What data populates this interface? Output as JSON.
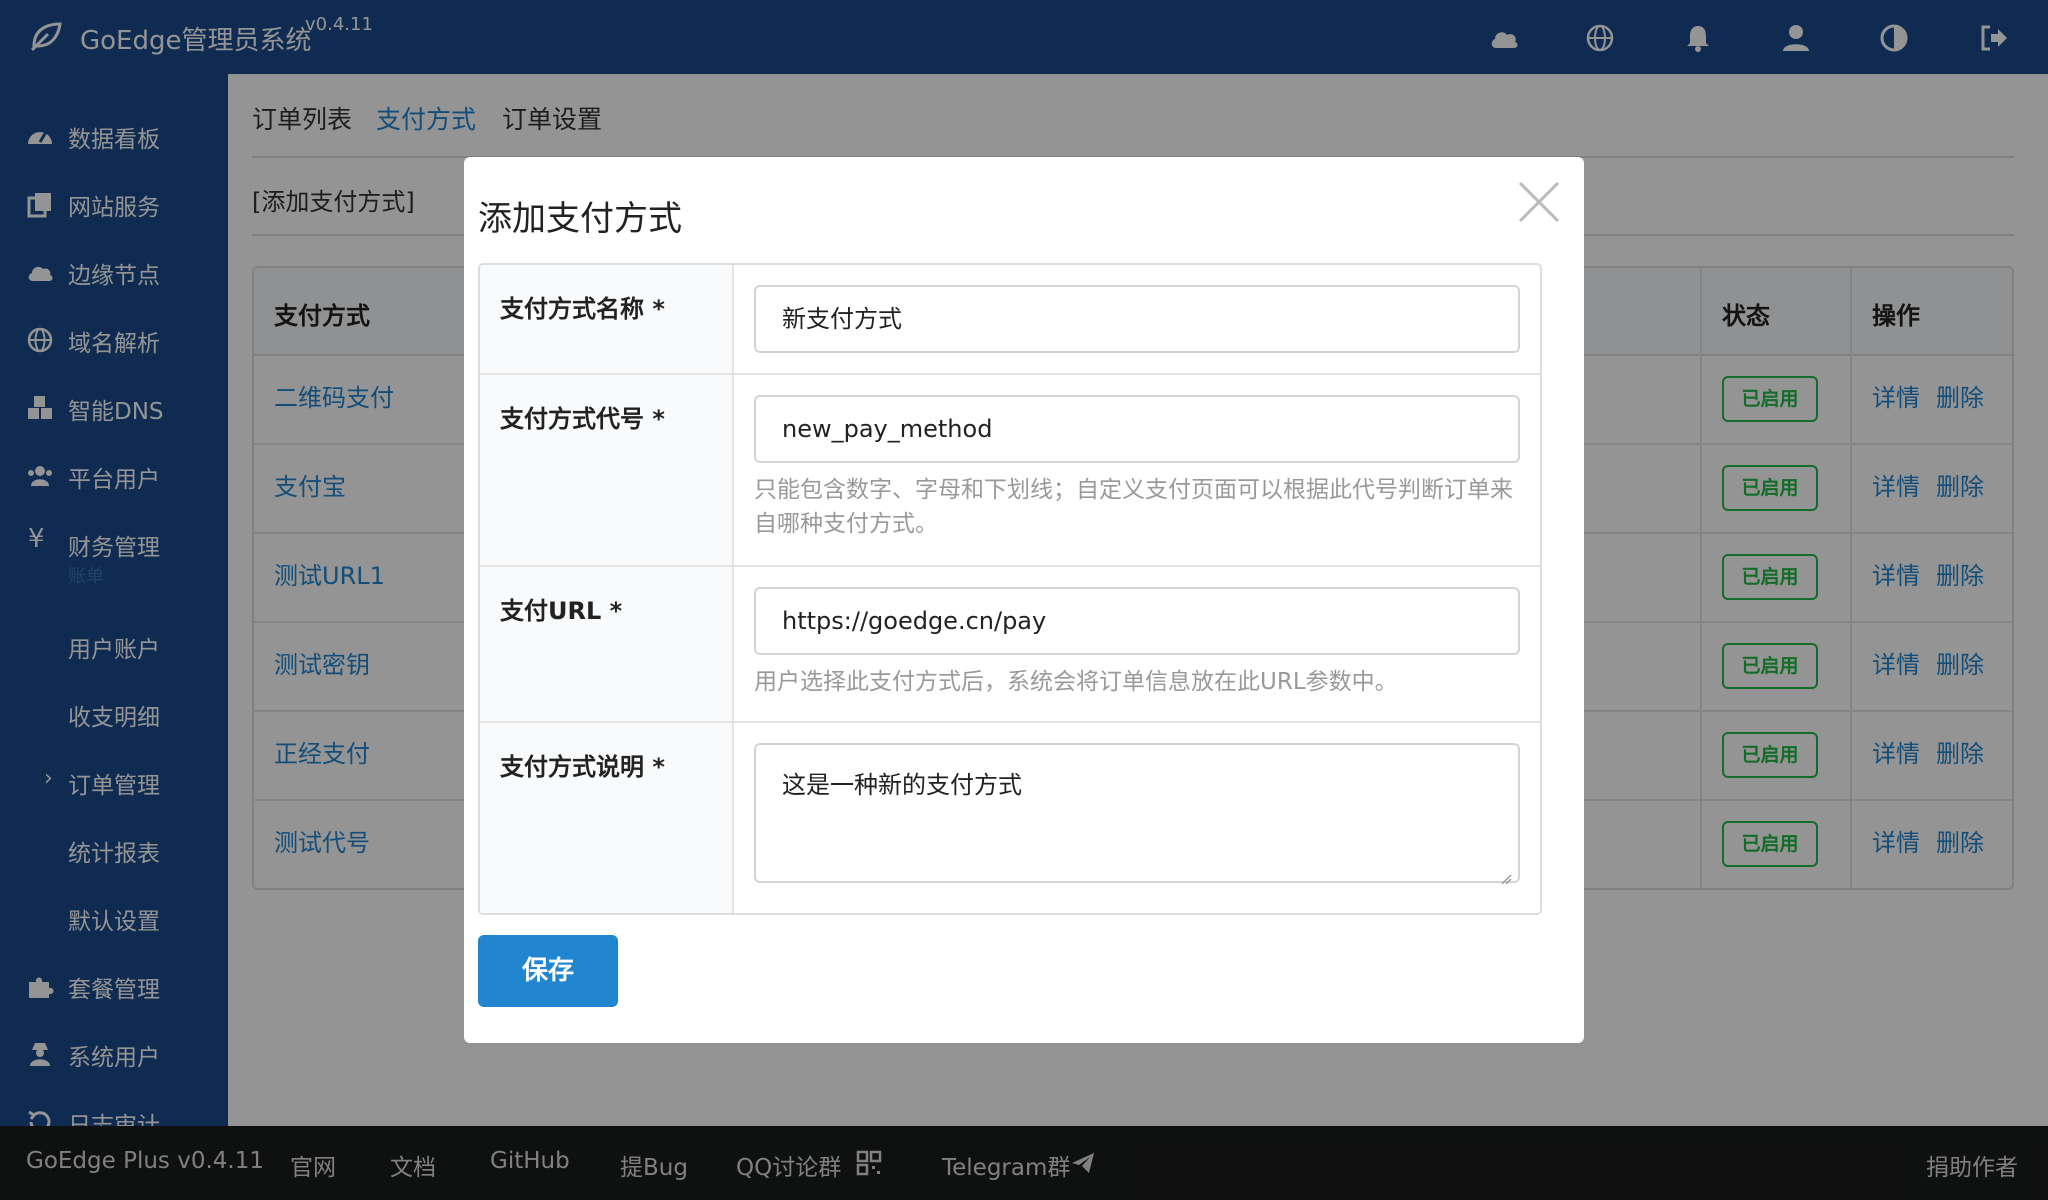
{
  "app": {
    "title": "GoEdge管理员系统",
    "version": "v0.4.11",
    "accent_color": "#1a4b8c",
    "link_color": "#2185d0",
    "success_color": "#21ba45"
  },
  "topbar": {
    "icons": [
      "cloud-icon",
      "globe-icon",
      "bell-icon",
      "user-icon",
      "contrast-icon",
      "logout-icon"
    ]
  },
  "sidebar": {
    "items": [
      {
        "label": "数据看板",
        "icon": "dashboard-icon"
      },
      {
        "label": "网站服务",
        "icon": "copy-icon"
      },
      {
        "label": "边缘节点",
        "icon": "cloud-icon"
      },
      {
        "label": "域名解析",
        "icon": "globe-icon"
      },
      {
        "label": "智能DNS",
        "icon": "cubes-icon"
      },
      {
        "label": "平台用户",
        "icon": "users-icon"
      },
      {
        "label": "财务管理",
        "icon": "yen-icon",
        "sub": "账单"
      },
      {
        "label": "套餐管理",
        "icon": "puzzle-icon"
      },
      {
        "label": "系统用户",
        "icon": "user-secret-icon"
      },
      {
        "label": "日志审计",
        "icon": "history-icon"
      }
    ],
    "finance_children": [
      "用户账户",
      "收支明细",
      "订单管理",
      "统计报表",
      "默认设置"
    ],
    "active_child": "订单管理"
  },
  "tabs": [
    "订单列表",
    "支付方式",
    "订单设置"
  ],
  "active_tab": "支付方式",
  "add_link": "[添加支付方式]",
  "table": {
    "headers": {
      "method": "支付方式",
      "status": "状态",
      "ops": "操作"
    },
    "rows": [
      {
        "name": "二维码支付",
        "status": "已启用"
      },
      {
        "name": "支付宝",
        "status": "已启用"
      },
      {
        "name": "测试URL1",
        "status": "已启用"
      },
      {
        "name": "测试密钥",
        "status": "已启用"
      },
      {
        "name": "正经支付",
        "status": "已启用"
      },
      {
        "name": "测试代号",
        "status": "已启用"
      }
    ],
    "detail_label": "详情",
    "delete_label": "删除"
  },
  "footer": {
    "items": [
      "GoEdge Plus v0.4.11",
      "官网",
      "文档",
      "GitHub",
      "提Bug",
      "QQ讨论群",
      "Telegram群"
    ],
    "donate": "捐助作者"
  },
  "modal": {
    "title": "添加支付方式",
    "fields": {
      "name": {
        "label": "支付方式名称 *",
        "value": "新支付方式"
      },
      "code": {
        "label": "支付方式代号 *",
        "value": "new_pay_method",
        "help": "只能包含数字、字母和下划线；自定义支付页面可以根据此代号判断订单来自哪种支付方式。"
      },
      "url": {
        "label": "支付URL *",
        "value": "https://goedge.cn/pay",
        "help": "用户选择此支付方式后，系统会将订单信息放在此URL参数中。"
      },
      "description": {
        "label": "支付方式说明 *",
        "value": "这是一种新的支付方式"
      }
    },
    "save_label": "保存"
  }
}
